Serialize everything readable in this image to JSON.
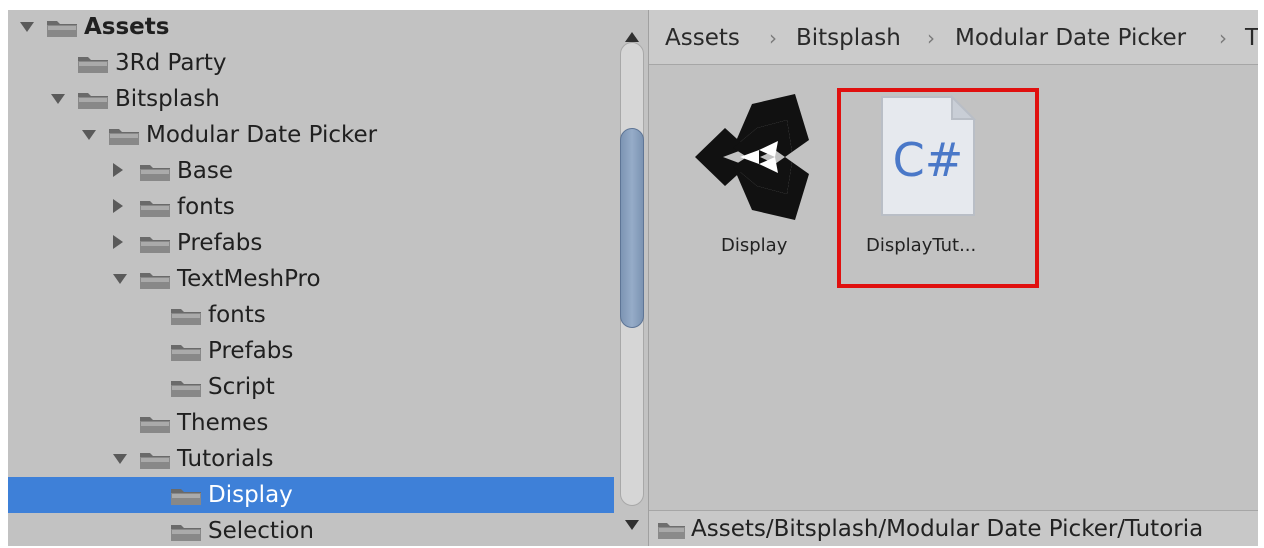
{
  "tree": {
    "items": [
      {
        "label": "Assets",
        "expanded": true,
        "icon": "folder-icon"
      },
      {
        "label": "3Rd Party",
        "expanded": null,
        "icon": "folder-icon"
      },
      {
        "label": "Bitsplash",
        "expanded": true,
        "icon": "folder-icon"
      },
      {
        "label": "Modular Date Picker",
        "expanded": true,
        "icon": "folder-icon"
      },
      {
        "label": "Base",
        "expanded": false,
        "icon": "folder-icon"
      },
      {
        "label": "fonts",
        "expanded": false,
        "icon": "folder-icon"
      },
      {
        "label": "Prefabs",
        "expanded": false,
        "icon": "folder-icon"
      },
      {
        "label": "TextMeshPro",
        "expanded": true,
        "icon": "folder-icon"
      },
      {
        "label": "fonts",
        "expanded": null,
        "icon": "folder-icon"
      },
      {
        "label": "Prefabs",
        "expanded": null,
        "icon": "folder-icon"
      },
      {
        "label": "Script",
        "expanded": null,
        "icon": "folder-icon"
      },
      {
        "label": "Themes",
        "expanded": null,
        "icon": "folder-icon"
      },
      {
        "label": "Tutorials",
        "expanded": true,
        "icon": "folder-icon"
      },
      {
        "label": "Display",
        "expanded": null,
        "icon": "folder-icon",
        "selected": true
      },
      {
        "label": "Selection",
        "expanded": null,
        "icon": "folder-icon"
      }
    ]
  },
  "breadcrumb": {
    "items": [
      "Assets",
      "Bitsplash",
      "Modular Date Picker",
      "T"
    ],
    "separator": "›"
  },
  "assets": [
    {
      "label": "Display",
      "icon": "unity-scene-icon"
    },
    {
      "label": "DisplayTut...",
      "icon": "csharp-script-icon",
      "icon_text": "C#",
      "highlighted": true
    }
  ],
  "status": {
    "path": "Assets/Bitsplash/Modular Date Picker/Tutoria",
    "icon": "folder-icon"
  },
  "colors": {
    "selection": "#3e80d8",
    "highlight_border": "#e0100f",
    "panel_bg": "#c2c2c2",
    "csharp_text": "#4a78c8"
  }
}
